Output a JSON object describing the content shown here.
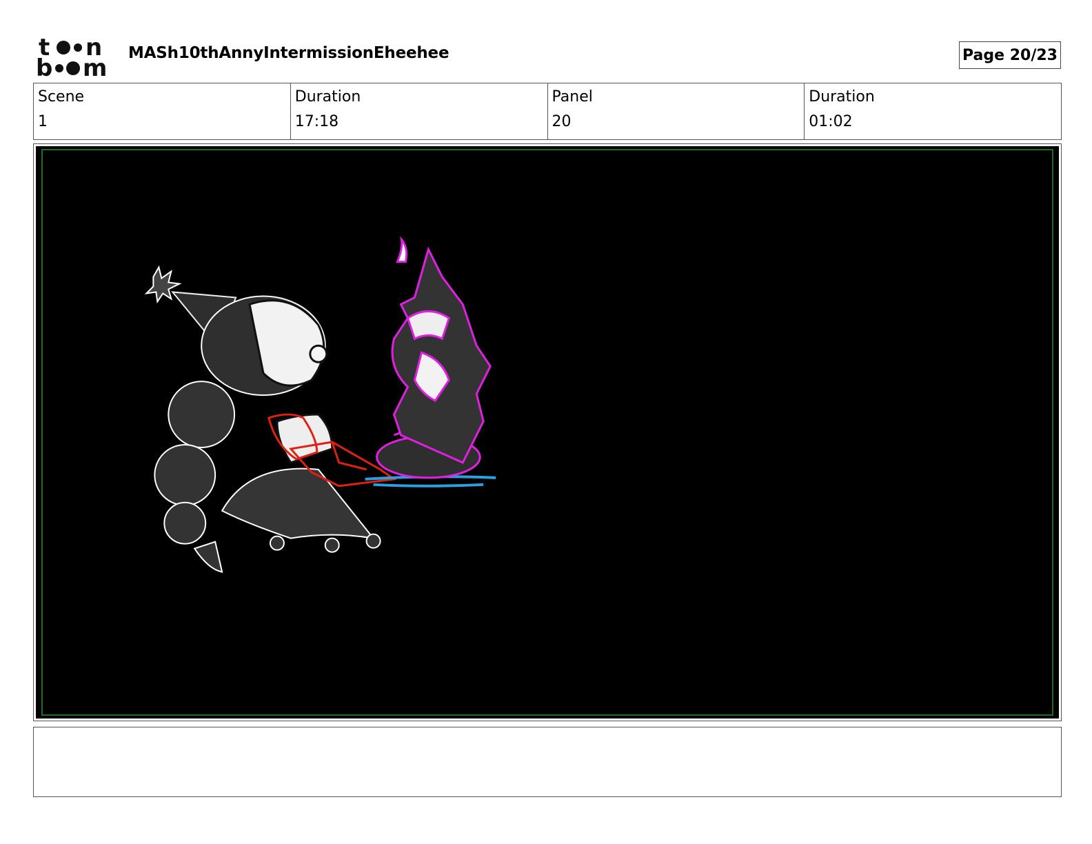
{
  "header": {
    "logo_name": "toon boom",
    "title": "MASh10thAnnyIntermissionEheehee",
    "page_label": "Page 20/23"
  },
  "info": {
    "scene_label": "Scene",
    "scene_value": "1",
    "scene_duration_label": "Duration",
    "scene_duration_value": "17:18",
    "panel_label": "Panel",
    "panel_value": "20",
    "panel_duration_label": "Duration",
    "panel_duration_value": "01:02"
  },
  "panel": {
    "background_color": "#000000",
    "safe_frame_color": "#1f6b2a",
    "sketch_colors": {
      "character": "#333333",
      "cake_outline": "#e020e0",
      "arm_outline": "#e02010",
      "tray": "#2aa0e0"
    }
  },
  "notes": {
    "text": ""
  }
}
